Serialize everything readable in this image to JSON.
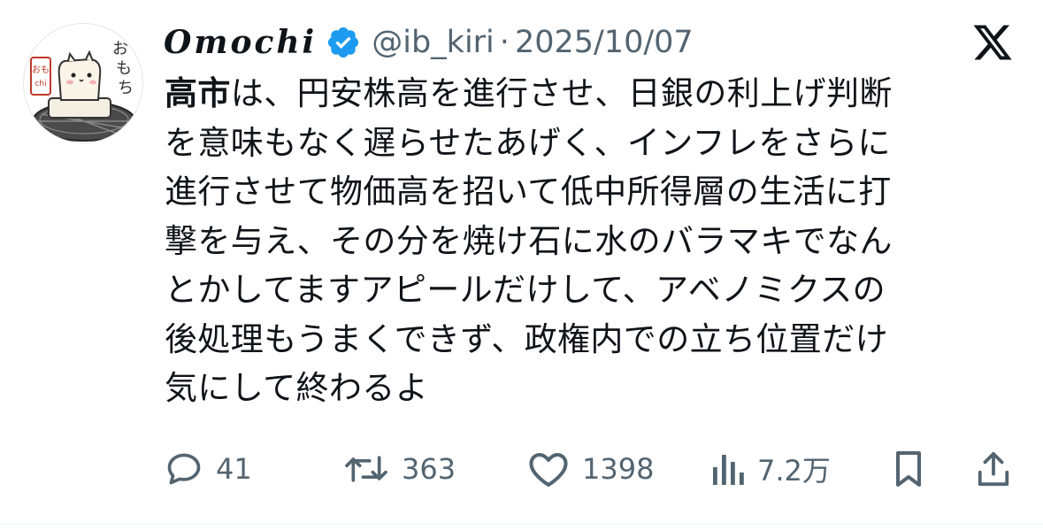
{
  "author": {
    "display_name": "Omochi",
    "handle": "@ib_kiri",
    "separator": "·",
    "date": "2025/10/07",
    "avatar_text": "おもち"
  },
  "tweet": {
    "bold_text": "高市",
    "lines": [
      "は、円安株高を進行させ、日銀の利上げ判断",
      "を意味もなく遅らせたあげく、インフレをさらに",
      "進行させて物価高を招いて低中所得層の生活に打",
      "撃を与え、その分を焼け石に水のバラマキでなん",
      "とかしてますアピールだけして、アベノミクスの",
      "後処理もうまくできず、政権内での立ち位置だけ",
      "気にして終わるよ"
    ]
  },
  "actions": {
    "replies": "41",
    "reposts": "363",
    "likes": "1398",
    "views": "7.2万"
  },
  "icons": [
    "x-logo-icon",
    "verified-badge-icon",
    "reply-icon",
    "repost-icon",
    "like-icon",
    "views-icon",
    "bookmark-icon",
    "share-icon"
  ],
  "colors": {
    "verified": "#1d9bf0",
    "muted": "#536471",
    "text": "#0f1419"
  }
}
